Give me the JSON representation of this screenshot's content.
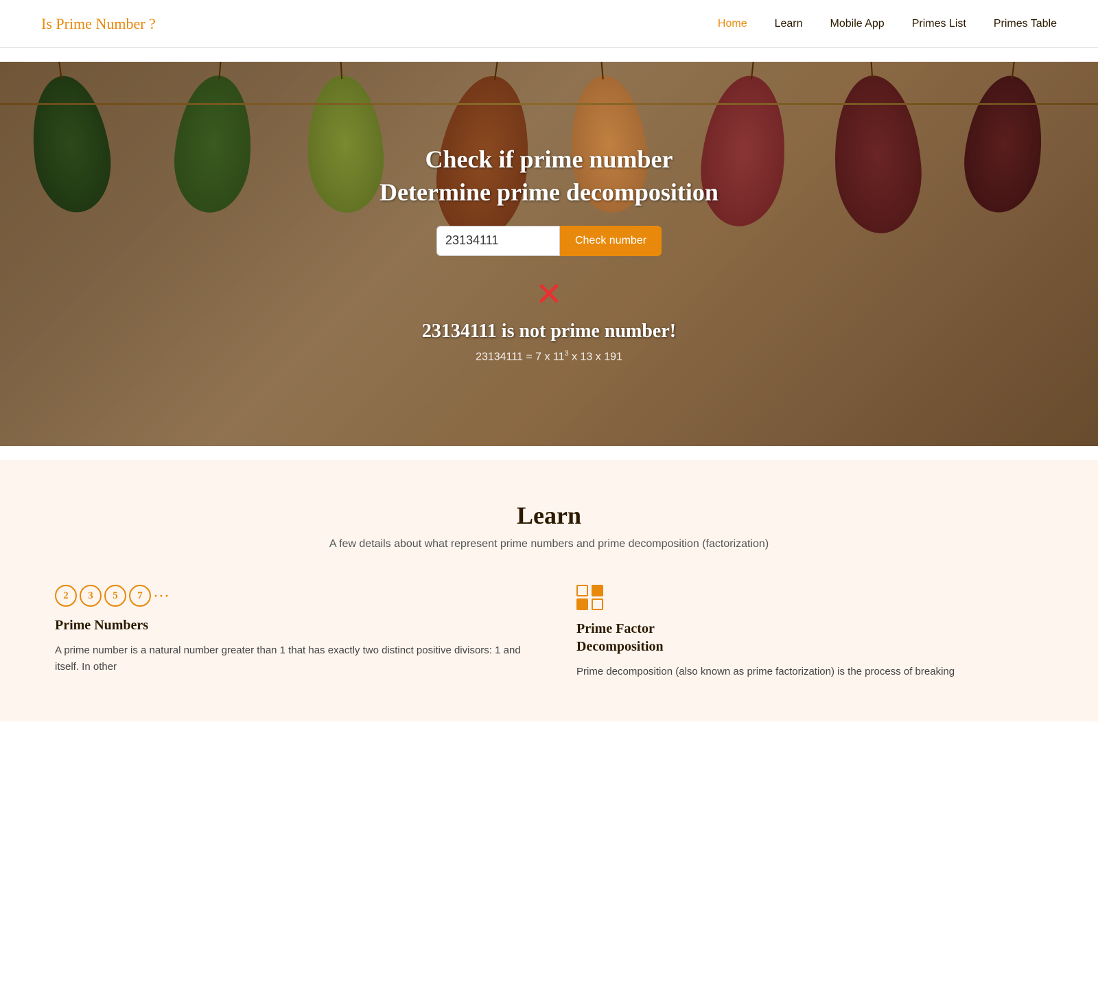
{
  "header": {
    "logo_text": "Is Prime Number",
    "logo_symbol": "?",
    "nav": [
      {
        "label": "Home",
        "active": true
      },
      {
        "label": "Learn",
        "active": false
      },
      {
        "label": "Mobile App",
        "active": false
      },
      {
        "label": "Primes List",
        "active": false
      },
      {
        "label": "Primes Table",
        "active": false
      }
    ]
  },
  "hero": {
    "title1": "Check if prime number",
    "title2": "Determine prime decomposition",
    "input_value": "23134111",
    "button_label": "Check number",
    "result_icon": "✕",
    "result_text": "23134111 is not prime number!",
    "result_formula_prefix": "23134111 = 7 x 11",
    "result_formula_exp": "3",
    "result_formula_suffix": " x 13 x 191"
  },
  "learn": {
    "title": "Learn",
    "subtitle": "A few details about what represent prime numbers and prime decomposition (factorization)",
    "cards": [
      {
        "heading": "Prime Numbers",
        "body": "A prime number is a natural number greater than 1 that has exactly two distinct positive divisors: 1 and itself. In other",
        "icon_numbers": [
          "2",
          "3",
          "5",
          "7"
        ],
        "has_dots": true
      },
      {
        "heading": "Prime Factor\nDecomposition",
        "body": "Prime decomposition (also known as prime factorization) is the process of breaking"
      }
    ]
  }
}
